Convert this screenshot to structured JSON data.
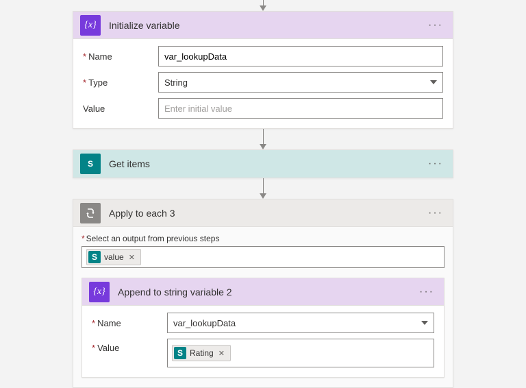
{
  "arrow_top_len": 8,
  "step1": {
    "title": "Initialize variable",
    "name_label": "Name",
    "name_value": "var_lookupData",
    "type_label": "Type",
    "type_value": "String",
    "value_label": "Value",
    "value_placeholder": "Enter initial value"
  },
  "step2": {
    "title": "Get items"
  },
  "each": {
    "title": "Apply to each 3",
    "select_label": "Select an output from previous steps",
    "token_label": "value"
  },
  "append": {
    "title": "Append to string variable 2",
    "name_label": "Name",
    "name_value": "var_lookupData",
    "value_label": "Value",
    "token_label": "Rating"
  },
  "icon_sp_char": "S",
  "icon_var_char": "{x}",
  "ellipsis": "···"
}
